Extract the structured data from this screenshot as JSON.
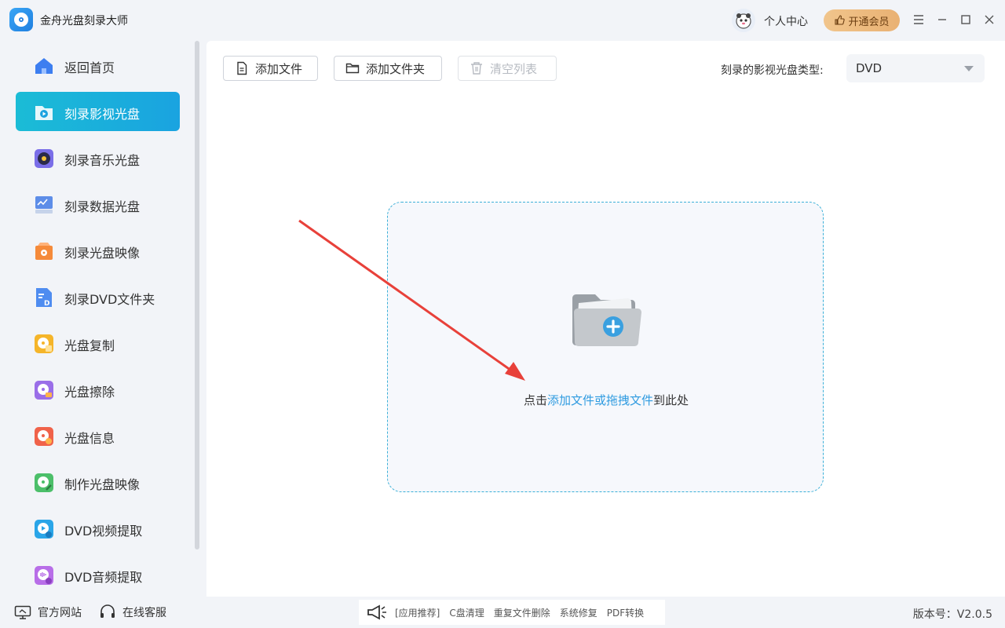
{
  "window": {
    "title": "金舟光盘刻录大师",
    "user_center": "个人中心",
    "vip_button": "开通会员"
  },
  "sidebar": {
    "items": [
      {
        "label": "返回首页",
        "icon": "home-icon"
      },
      {
        "label": "刻录影视光盘",
        "icon": "video-disc-icon",
        "active": true
      },
      {
        "label": "刻录音乐光盘",
        "icon": "music-disc-icon"
      },
      {
        "label": "刻录数据光盘",
        "icon": "data-disc-icon"
      },
      {
        "label": "刻录光盘映像",
        "icon": "disc-image-icon"
      },
      {
        "label": "刻录DVD文件夹",
        "icon": "dvd-folder-icon"
      },
      {
        "label": "光盘复制",
        "icon": "disc-copy-icon"
      },
      {
        "label": "光盘擦除",
        "icon": "disc-erase-icon"
      },
      {
        "label": "光盘信息",
        "icon": "disc-info-icon"
      },
      {
        "label": "制作光盘映像",
        "icon": "make-image-icon"
      },
      {
        "label": "DVD视频提取",
        "icon": "dvd-video-extract-icon"
      },
      {
        "label": "DVD音频提取",
        "icon": "dvd-audio-extract-icon"
      }
    ]
  },
  "toolbar": {
    "add_file": "添加文件",
    "add_folder": "添加文件夹",
    "clear_list": "清空列表",
    "disc_type_label": "刻录的影视光盘类型:",
    "disc_type_value": "DVD"
  },
  "dropzone": {
    "text_prefix": "点击",
    "text_link": "添加文件或拖拽文件",
    "text_suffix": "到此处"
  },
  "bottom": {
    "website": "官方网站",
    "support": "在线客服",
    "promo": [
      "[应用推荐]",
      "C盘清理",
      "重复文件删除",
      "系统修复",
      "PDF转换"
    ],
    "version": "版本号：V2.0.5"
  },
  "colors": {
    "accent": "#1aa3e0",
    "link": "#2f9be0",
    "arrow": "#e8413a",
    "vip": "#e9b173"
  }
}
